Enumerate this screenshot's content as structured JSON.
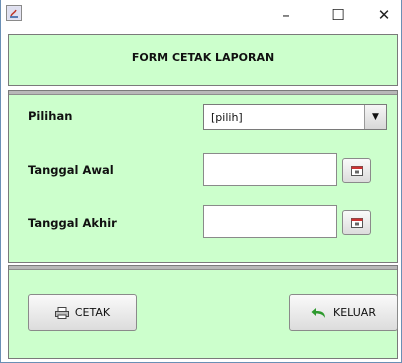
{
  "window": {
    "minimize_glyph": "–",
    "maximize_glyph": "☐",
    "close_glyph": "✕"
  },
  "header": {
    "title": "FORM CETAK LAPORAN"
  },
  "form": {
    "pilihan_label": "Pilihan",
    "pilihan_value": "[pilih]",
    "tanggal_awal_label": "Tanggal Awal",
    "tanggal_awal_value": "",
    "tanggal_akhir_label": "Tanggal Akhir",
    "tanggal_akhir_value": ""
  },
  "footer": {
    "cetak_label": "CETAK",
    "keluar_label": "KELUAR"
  },
  "colors": {
    "panel_bg": "#ccffcc",
    "window_bg": "#ffffff",
    "keluar_arrow": "#2e9a2e"
  }
}
